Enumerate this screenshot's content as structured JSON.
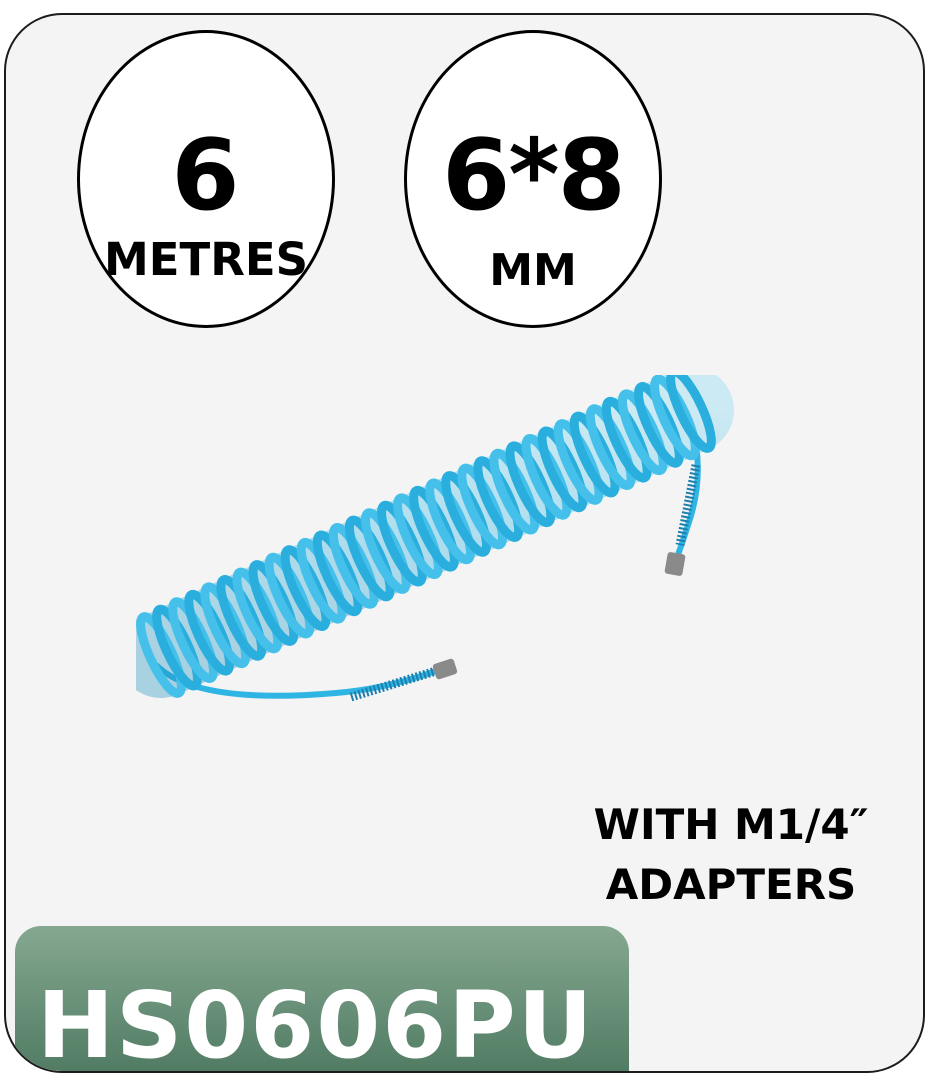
{
  "badge_length": {
    "value": "6",
    "unit": "METRES"
  },
  "badge_size": {
    "value": "6*8",
    "unit": "MM"
  },
  "product_image": {
    "icon": "coiled-air-hose-icon",
    "hose_color": "#2fb5e3"
  },
  "feature": {
    "line1": "WITH M1/4″",
    "line2": "ADAPTERS"
  },
  "product_code": "HS0606PU",
  "colors": {
    "card_background": "#f4f4f4",
    "code_tab": "#5a8a6d"
  }
}
